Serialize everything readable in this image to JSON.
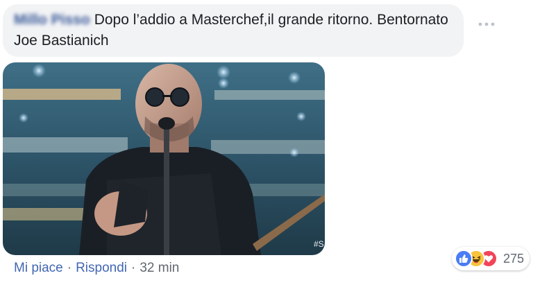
{
  "comment": {
    "author": "Millo Pisso",
    "text": "Dopo l’addio a Masterchef,il grande ritorno. Bentornato Joe Bastianich"
  },
  "media": {
    "watermark": "#S"
  },
  "actions": {
    "like_label": "Mi piace",
    "reply_label": "Rispondi",
    "separator": "·",
    "timestamp": "32 min"
  },
  "reactions": {
    "icons": [
      "like-icon",
      "haha-icon",
      "love-icon"
    ],
    "count": "275",
    "colors": {
      "like": "#4a7cf5",
      "haha": "#f7c43d",
      "love": "#f2445a"
    }
  },
  "colors": {
    "bubble_bg": "#f2f3f5",
    "link": "#4267b2",
    "meta": "#606770"
  }
}
